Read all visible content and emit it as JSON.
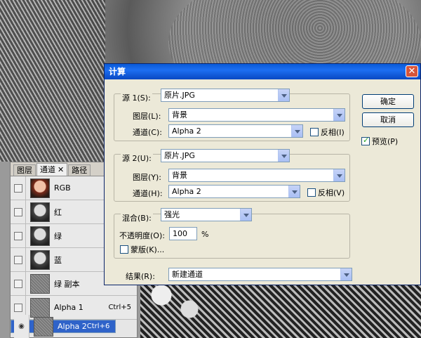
{
  "dialog": {
    "title": "计算",
    "close_label": "✕",
    "source1": {
      "label": "源 1(S):",
      "file": "原片.JPG",
      "layer_label": "图层(L):",
      "layer": "背景",
      "channel_label": "通道(C):",
      "channel": "Alpha 2",
      "invert_label": "反相(I)"
    },
    "source2": {
      "label": "源 2(U):",
      "file": "原片.JPG",
      "layer_label": "图层(Y):",
      "layer": "背景",
      "channel_label": "通道(H):",
      "channel": "Alpha 2",
      "invert_label": "反相(V)"
    },
    "blend": {
      "label": "混合(B):",
      "mode": "强光",
      "opacity_label": "不透明度(O):",
      "opacity": "100",
      "percent": "%",
      "mask_label": "蒙版(K)..."
    },
    "result": {
      "label": "结果(R):",
      "value": "新建通道"
    },
    "ok_label": "确定",
    "cancel_label": "取消",
    "preview_label": "预览(P)"
  },
  "panel": {
    "tabs": [
      {
        "label": "图层"
      },
      {
        "label": "通道"
      },
      {
        "label": "路径"
      }
    ],
    "tab_close": "✕",
    "channels": [
      {
        "name": "RGB",
        "shortcut": ""
      },
      {
        "name": "红",
        "shortcut": ""
      },
      {
        "name": "绿",
        "shortcut": ""
      },
      {
        "name": "蓝",
        "shortcut": ""
      },
      {
        "name": "绿 副本",
        "shortcut": ""
      },
      {
        "name": "Alpha 1",
        "shortcut": "Ctrl+5"
      },
      {
        "name": "Alpha 2",
        "shortcut": "Ctrl+6"
      }
    ]
  }
}
